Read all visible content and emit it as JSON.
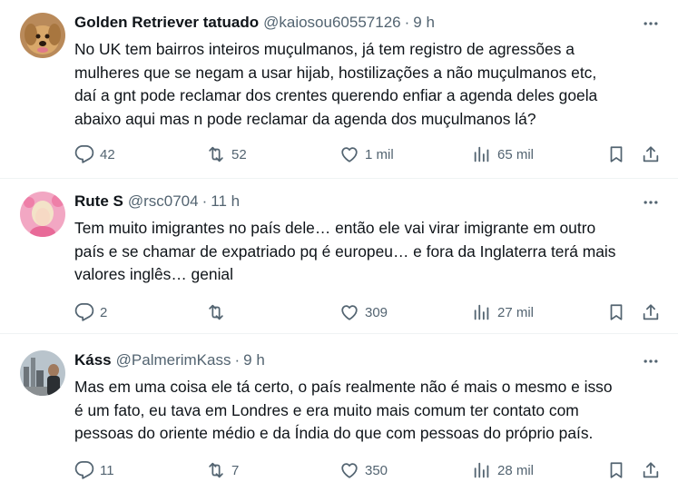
{
  "tweets": [
    {
      "name": "Golden Retriever tatuado",
      "handle": "@kaiosou60557126",
      "separator": "·",
      "time": "9 h",
      "lines": [
        "No UK tem bairros inteiros muçulmanos, já tem registro de agressões a",
        "mulheres que se negam a usar hijab, hostilizações a não muçulmanos etc,",
        "daí a gnt pode reclamar dos crentes querendo enfiar a agenda deles goela",
        "abaixo aqui mas n pode reclamar da agenda dos muçulmanos lá?"
      ],
      "replies": "42",
      "reposts": "52",
      "likes": "1 mil",
      "views": "65 mil"
    },
    {
      "name": "Rute S",
      "handle": "@rsc0704",
      "separator": "·",
      "time": "11 h",
      "lines": [
        "Tem muito imigrantes no país dele… então ele vai virar imigrante em outro",
        "país e se chamar de expatriado pq é europeu… e fora da Inglaterra terá mais",
        "valores inglês… genial"
      ],
      "replies": "2",
      "reposts": "",
      "likes": "309",
      "views": "27 mil"
    },
    {
      "name": "Káss",
      "handle": "@PalmerimKass",
      "separator": "·",
      "time": "9 h",
      "lines": [
        "Mas em uma coisa ele tá certo, o país realmente não é mais o mesmo e isso",
        "é um fato, eu tava em Londres e era muito mais comum ter contato com",
        "pessoas do oriente médio e da Índia do que com pessoas do próprio país."
      ],
      "replies": "11",
      "reposts": "7",
      "likes": "350",
      "views": "28 mil"
    }
  ],
  "icons": {
    "reply": "reply-icon",
    "repost": "repost-icon",
    "like": "heart-icon",
    "views": "views-icon",
    "bookmark": "bookmark-icon",
    "share": "share-icon",
    "more": "more-icon"
  },
  "colors": {
    "text": "#0f1419",
    "secondary": "#536471",
    "border": "#eff3f4"
  }
}
